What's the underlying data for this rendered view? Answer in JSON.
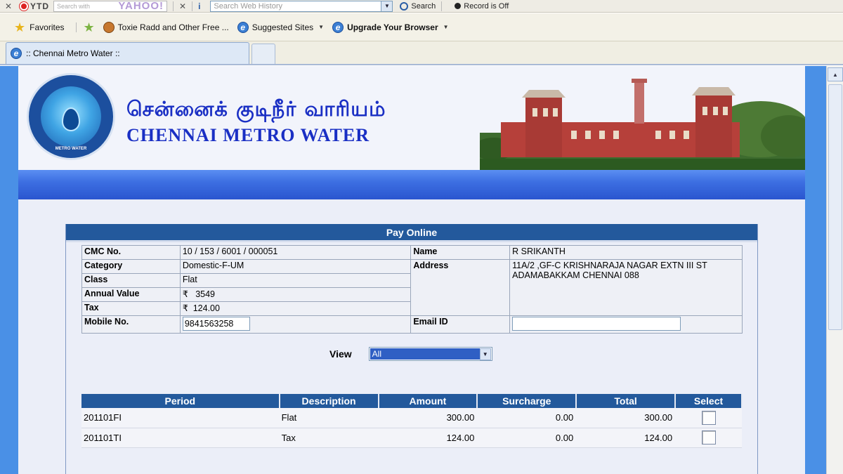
{
  "browser": {
    "ytd_label": "YTD",
    "yahoo_placeholder": "Search with",
    "yahoo_brand": "YAHOO!",
    "web_history_placeholder": "Search Web History",
    "search_label": "Search",
    "record_label": "Record is Off",
    "favorites_label": "Favorites",
    "fav_links": [
      "Toxie Radd and Other Free ...",
      "Suggested Sites",
      "Upgrade Your Browser"
    ],
    "tab_title": ":: Chennai Metro Water ::"
  },
  "header": {
    "title_tamil": "சென்னைக் குடிநீர் வாரியம்",
    "title_english": "CHENNAI METRO WATER",
    "logo_text": "METRO WATER"
  },
  "panel": {
    "title": "Pay Online",
    "labels": {
      "cmc": "CMC No.",
      "category": "Category",
      "class": "Class",
      "annual_value": "Annual Value",
      "tax": "Tax",
      "mobile": "Mobile No.",
      "name": "Name",
      "address": "Address",
      "email": "Email ID"
    },
    "values": {
      "cmc": "10 / 153 / 6001 / 000051",
      "category": "Domestic-F-UM",
      "class": "Flat",
      "annual_value": "₹   3549",
      "tax": "₹  124.00",
      "mobile": "9841563258",
      "name": "R SRIKANTH",
      "address_line1": "11A/2 ,GF-C KRISHNARAJA NAGAR EXTN III ST",
      "address_line2": "ADAMABAKKAM CHENNAI 088",
      "email": ""
    },
    "view_label": "View",
    "view_selected": "All"
  },
  "bills": {
    "columns": [
      "Period",
      "Description",
      "Amount",
      "Surcharge",
      "Total",
      "Select"
    ],
    "rows": [
      {
        "period": "201101FI",
        "description": "Flat",
        "amount": "300.00",
        "surcharge": "0.00",
        "total": "300.00",
        "selected": false
      },
      {
        "period": "201101TI",
        "description": "Tax",
        "amount": "124.00",
        "surcharge": "0.00",
        "total": "124.00",
        "selected": false
      }
    ]
  }
}
